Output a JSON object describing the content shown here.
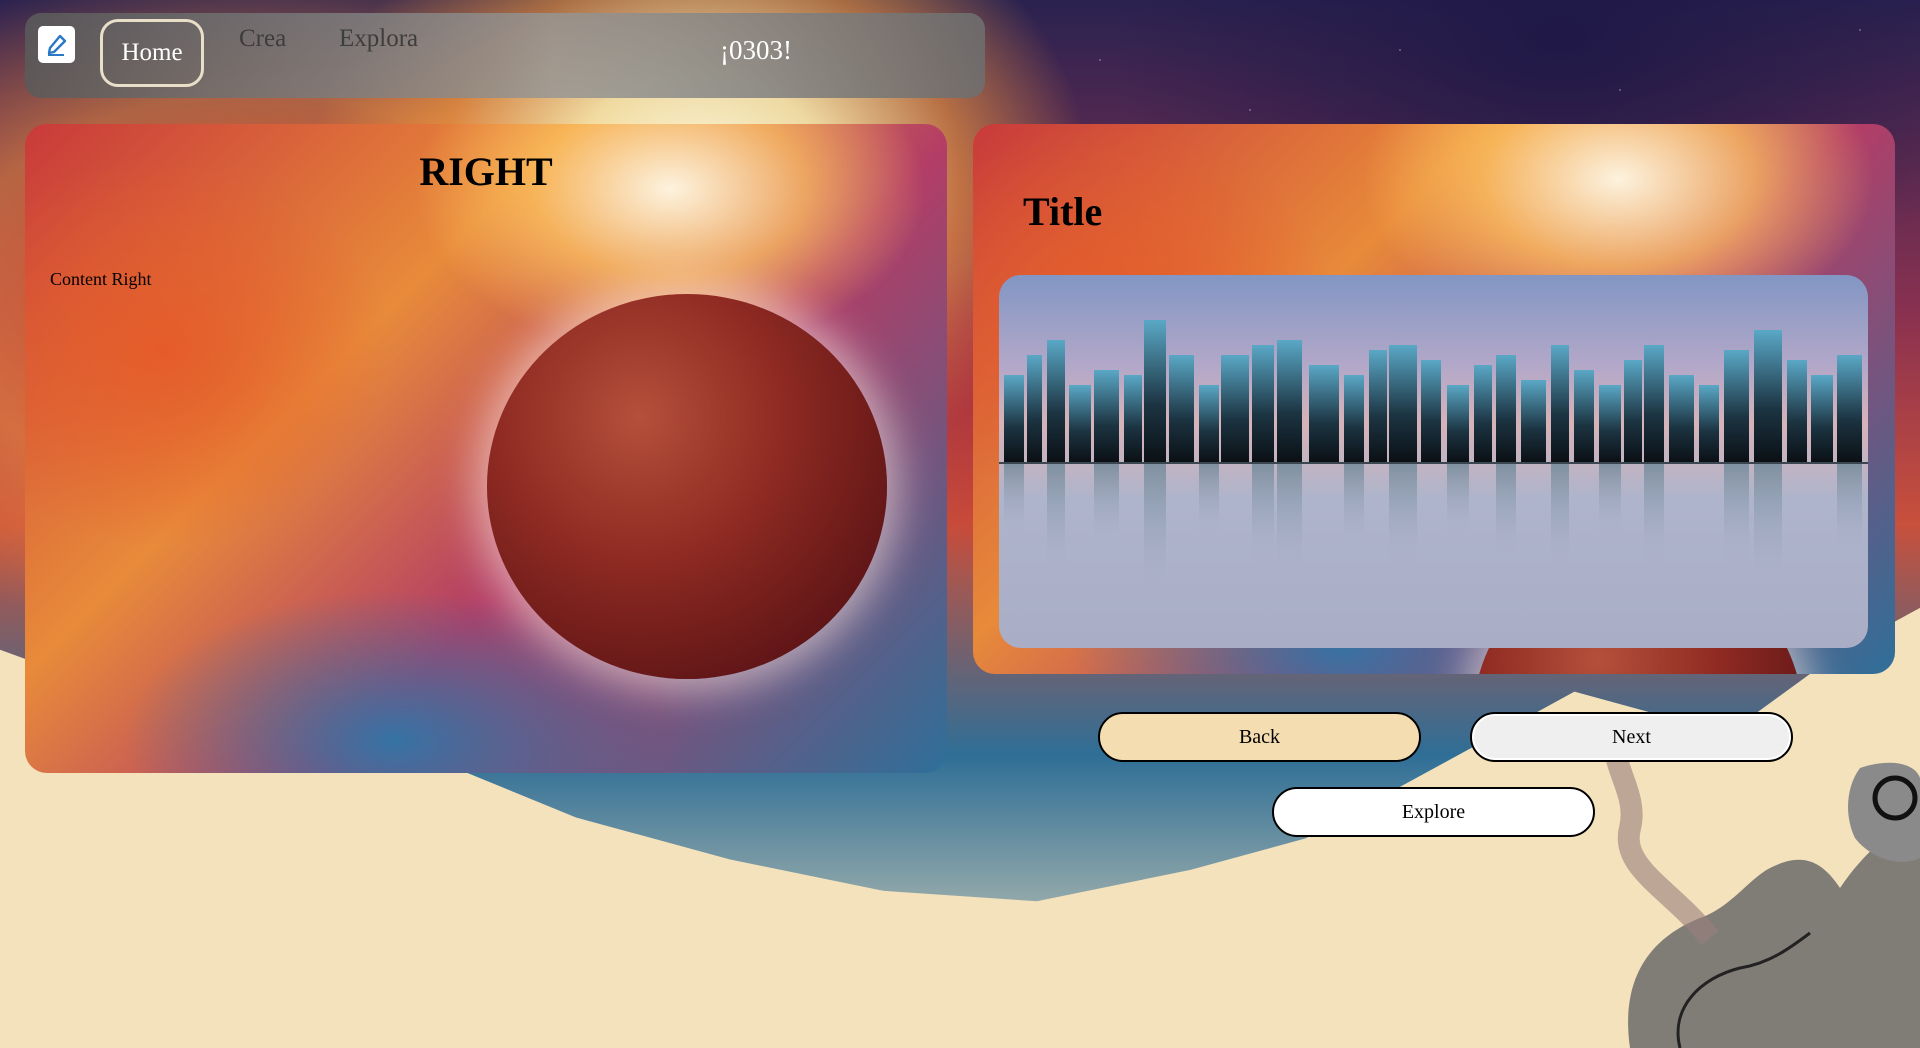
{
  "navbar": {
    "logo_icon": "pencil-icon",
    "home_label": "Home",
    "crea_label": "Crea",
    "explora_label": "Explora",
    "counter_text": "¡0303!"
  },
  "left_card": {
    "title": "RIGHT",
    "content": "Content Right"
  },
  "right_card": {
    "title": "Title",
    "image_alt": "city-skyline-image"
  },
  "buttons": {
    "back_label": "Back",
    "next_label": "Next",
    "explore_label": "Explore"
  },
  "colors": {
    "back_button_bg": "#f4ddb0",
    "next_button_bg": "#efefef",
    "explore_button_bg": "#ffffff",
    "page_background": "#f4e2bd"
  }
}
